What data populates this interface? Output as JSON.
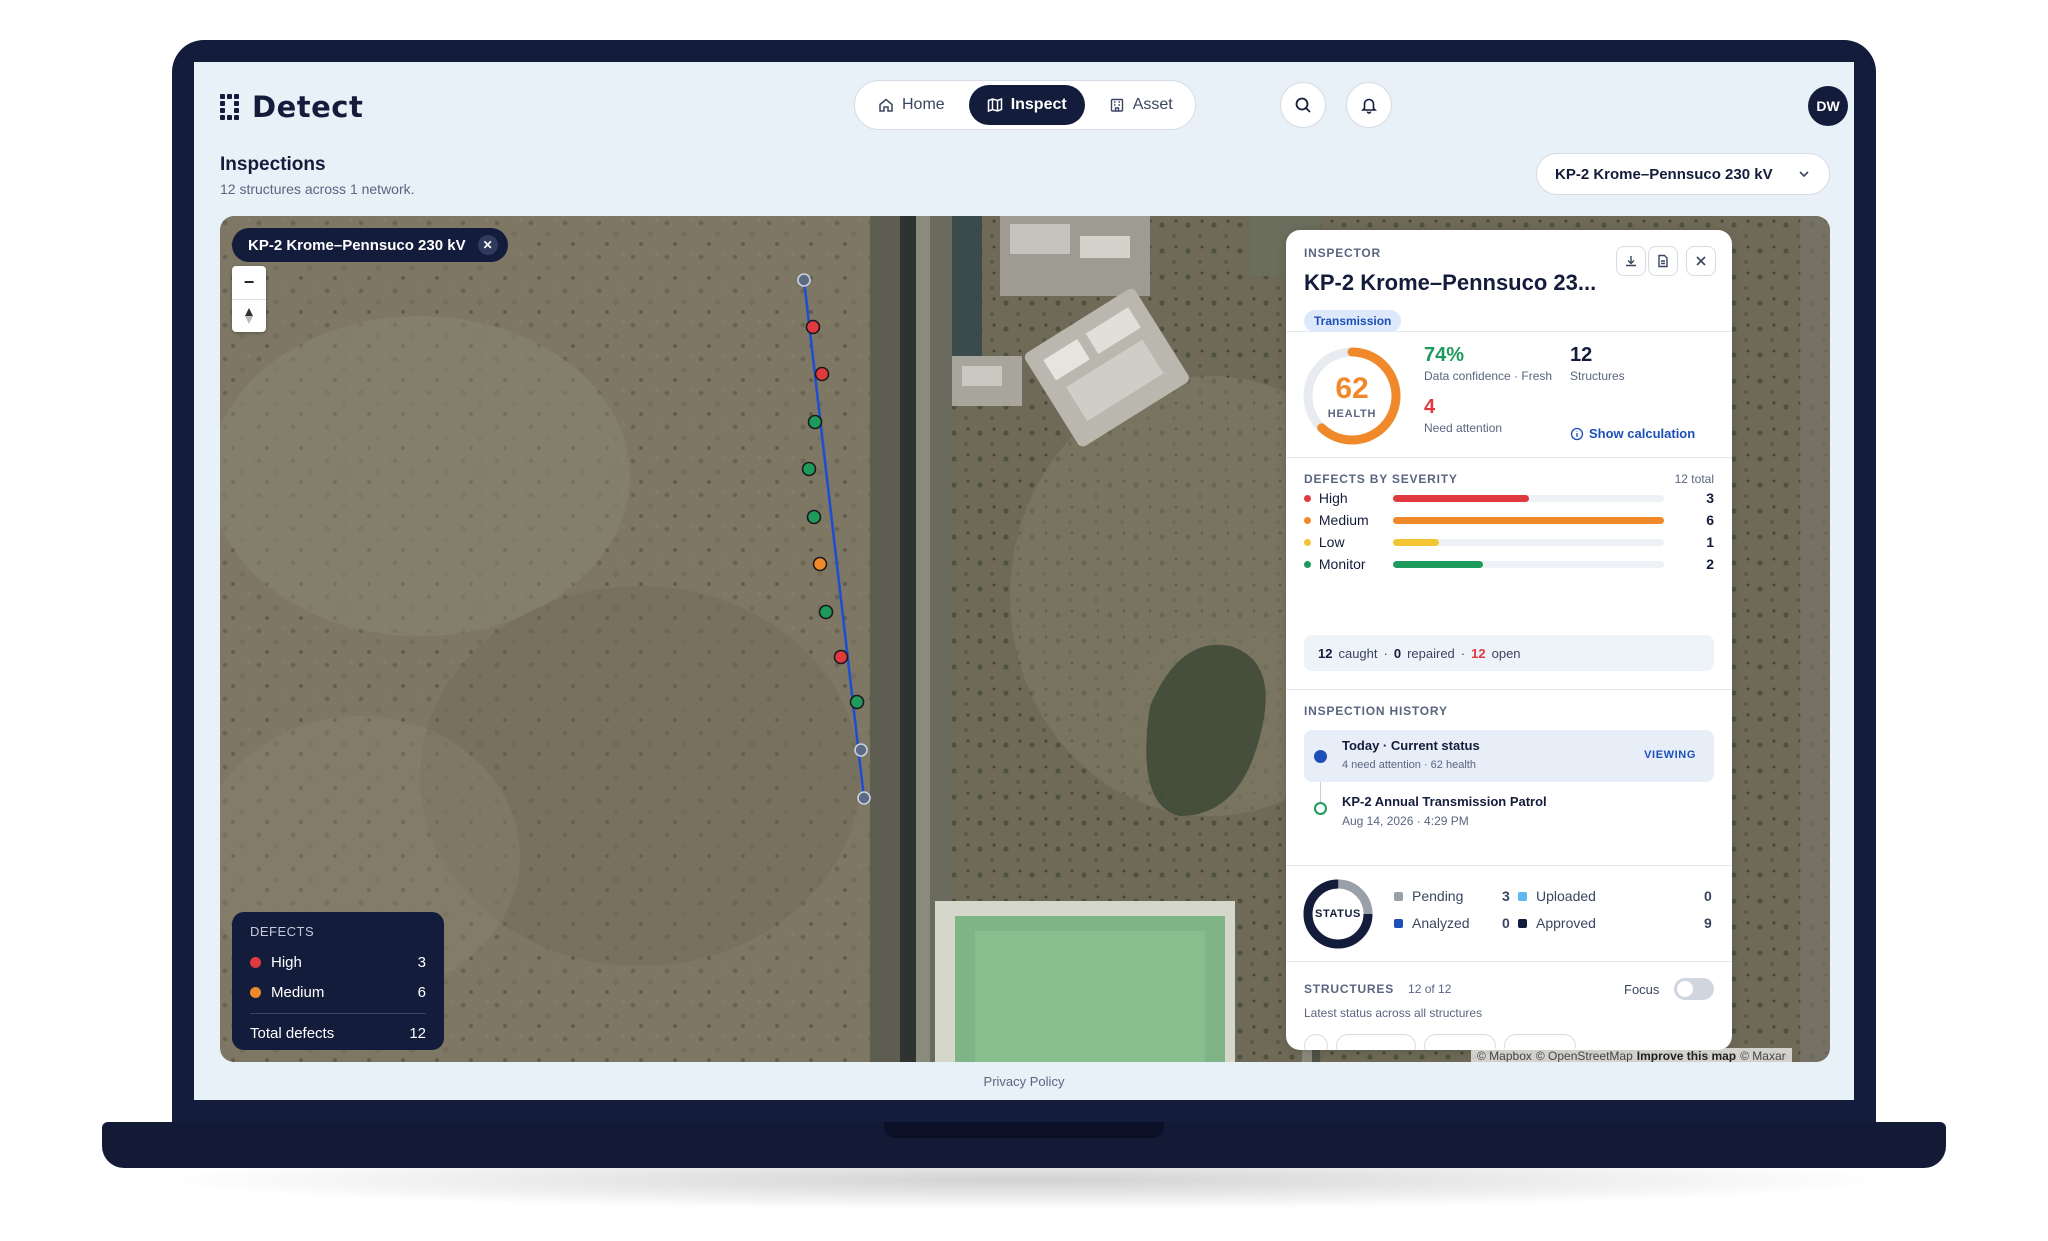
{
  "app": {
    "name": "Detect"
  },
  "nav": [
    {
      "label": "Home",
      "icon": "home-icon",
      "active": false
    },
    {
      "label": "Inspect",
      "icon": "map-icon",
      "active": true
    },
    {
      "label": "Asset",
      "icon": "building-icon",
      "active": false
    }
  ],
  "user": {
    "initials": "DW"
  },
  "page": {
    "title": "Inspections",
    "subtitle": "12 structures across 1 network.",
    "network_selected": "KP-2 Krome–Pennsuco 230 kV"
  },
  "map": {
    "chip_label": "KP-2 Krome–Pennsuco 230 kV",
    "legend": {
      "title": "DEFECTS",
      "items": [
        {
          "label": "High",
          "count": "3",
          "color": "#e0393e"
        },
        {
          "label": "Medium",
          "count": "6",
          "color": "#f0892a"
        }
      ],
      "total_label": "Total defects",
      "total": "12"
    },
    "attribution": {
      "mapbox": "© Mapbox",
      "osm": "© OpenStreetMap",
      "improve": "Improve this map",
      "maxar": "© Maxar"
    }
  },
  "inspector": {
    "label": "INSPECTOR",
    "title": "KP-2 Krome–Pennsuco 23...",
    "tag": "Transmission",
    "health": {
      "value": "62",
      "label": "HEALTH",
      "fraction": 0.62
    },
    "confidence": {
      "value": "74%",
      "label": "Data confidence · Fresh"
    },
    "structures": {
      "value": "12",
      "label": "Structures"
    },
    "attention": {
      "value": "4",
      "label": "Need attention"
    },
    "show_calc": "Show calculation",
    "severity": {
      "label": "DEFECTS BY SEVERITY",
      "total": "12 total",
      "rows": [
        {
          "name": "High",
          "value": "3",
          "fill": 0.5,
          "color": "#e0393e"
        },
        {
          "name": "Medium",
          "value": "6",
          "fill": 1.0,
          "color": "#f0892a"
        },
        {
          "name": "Low",
          "value": "1",
          "fill": 0.17,
          "color": "#f3c534"
        },
        {
          "name": "Monitor",
          "value": "2",
          "fill": 0.33,
          "color": "#1e9a5c"
        }
      ],
      "summary": {
        "caught": "12",
        "caught_label": "caught",
        "repaired": "0",
        "repaired_label": "repaired",
        "open": "12",
        "open_label": "open"
      }
    },
    "history": {
      "label": "INSPECTION HISTORY",
      "current": {
        "title": "Today · Current status",
        "sub": "4 need attention · 62 health",
        "badge": "VIEWING"
      },
      "past": {
        "title": "KP-2 Annual Transmission Patrol",
        "sub": "Aug 14, 2026 · 4:29 PM"
      }
    },
    "status": {
      "label": "STATUS",
      "items": [
        {
          "label": "Pending",
          "value": "3",
          "color": "#9aa0a8"
        },
        {
          "label": "Uploaded",
          "value": "0",
          "color": "#5bb8ee"
        },
        {
          "label": "Analyzed",
          "value": "0",
          "color": "#1d4fb8"
        },
        {
          "label": "Approved",
          "value": "9",
          "color": "#141c3b"
        }
      ]
    },
    "structures_sec": {
      "label": "STRUCTURES",
      "count": "12 of 12",
      "focus": "Focus",
      "sub": "Latest status across all structures"
    }
  },
  "footer": {
    "privacy": "Privacy Policy"
  }
}
